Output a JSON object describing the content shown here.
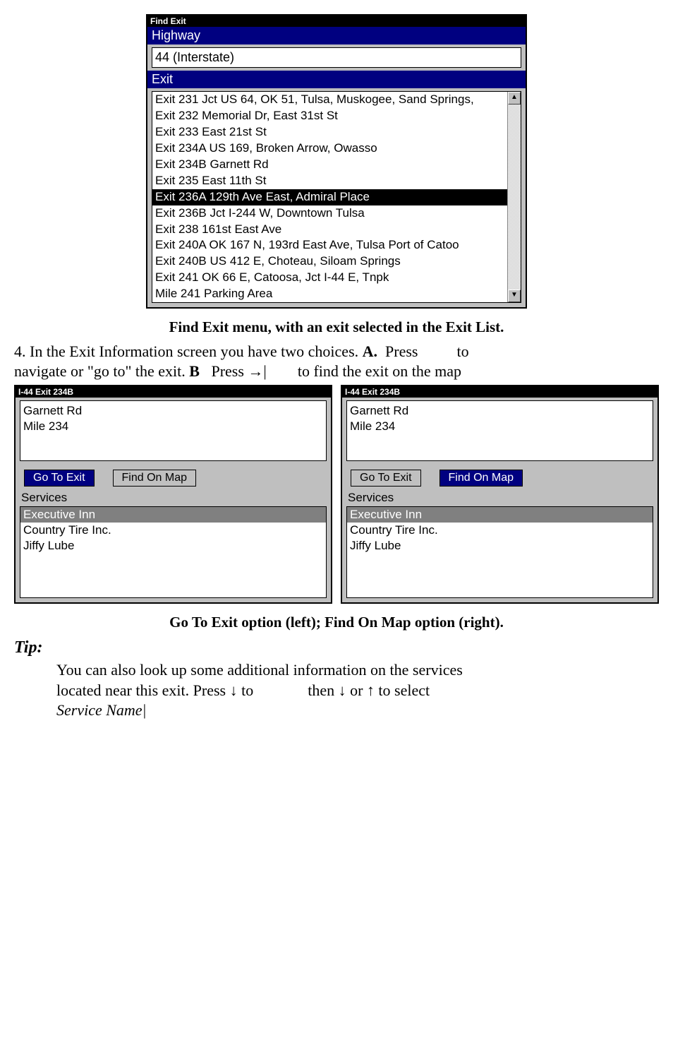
{
  "find_exit": {
    "title": "Find Exit",
    "highway_label": "Highway",
    "highway_value": "44 (Interstate)",
    "exit_label": "Exit",
    "exits": [
      "Exit 231 Jct US 64, OK 51, Tulsa, Muskogee, Sand Springs,",
      "Exit 232 Memorial Dr, East 31st St",
      "Exit 233 East 21st St",
      "Exit 234A US 169, Broken Arrow, Owasso",
      "Exit 234B Garnett Rd",
      "Exit 235 East 11th St",
      "Exit 236A 129th Ave East, Admiral Place",
      "Exit 236B Jct I-244 W, Downtown Tulsa",
      "Exit 238 161st East Ave",
      "Exit 240A OK 167 N, 193rd East Ave, Tulsa Port of Catoo",
      "Exit 240B US 412 E, Choteau, Siloam Springs",
      "Exit 241 OK 66 E, Catoosa, Jct I-44 E, Tnpk",
      "Mile 241 Parking Area"
    ],
    "selected_index": 6
  },
  "caption1": "Find Exit menu, with an exit selected in the Exit List.",
  "step4_line1": "4. In the Exit Information screen you have two choices. ",
  "step4_a": "A.",
  "step4_a_tail": " Press          to",
  "step4_line2a": "navigate or \"go to\" the exit. ",
  "step4_b": "B",
  "step4_line2b": "  Press →|        to find the exit on the map",
  "panel": {
    "title": "I-44 Exit 234B",
    "info_line1": "Garnett Rd",
    "info_line2": "Mile 234",
    "go_to": "Go To Exit",
    "find_map": "Find On Map",
    "services_label": "Services",
    "services": [
      "Executive Inn",
      "Country Tire Inc.",
      "Jiffy Lube"
    ],
    "selected_service": 0
  },
  "caption2": "Go To Exit option (left); Find On Map option (right).",
  "tip_label": "Tip:",
  "tip_line1": "You can also look up some additional information on the services",
  "tip_line2": "located near this exit. Press ↓ to              then ↓ or ↑ to select",
  "tip_line3": "Service Name|"
}
